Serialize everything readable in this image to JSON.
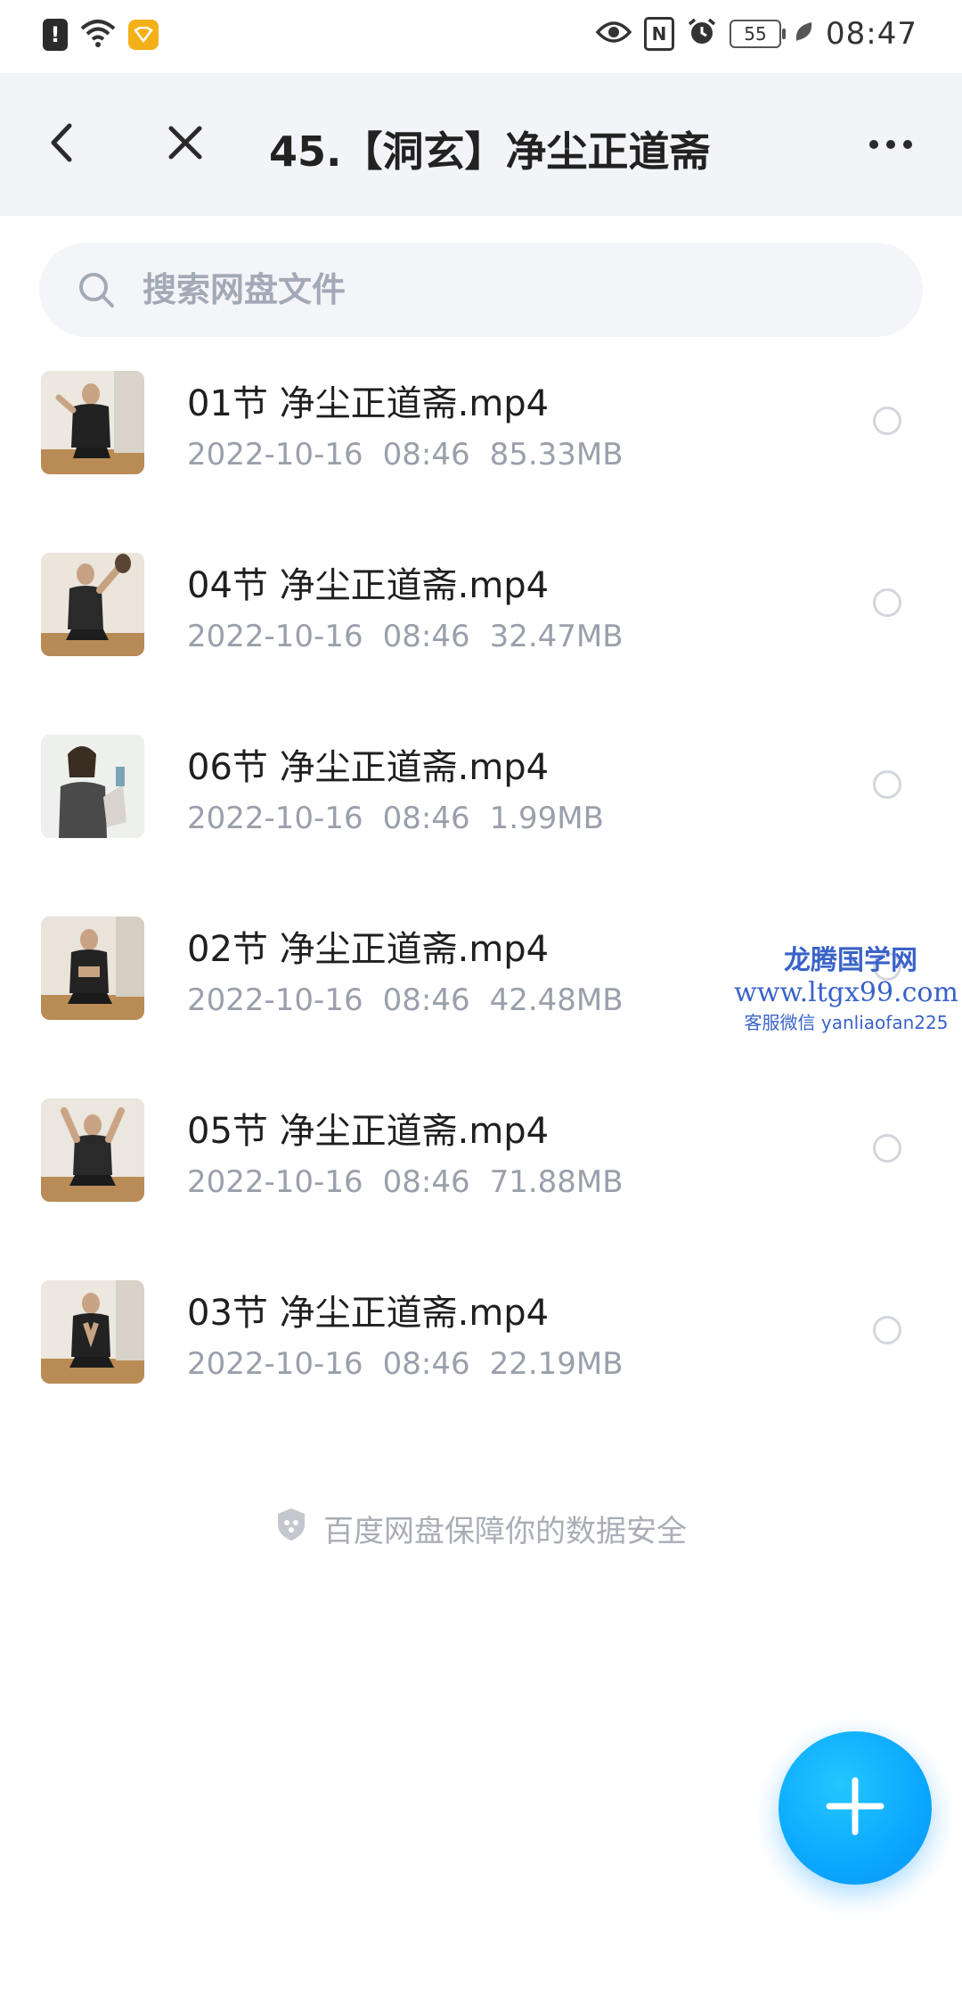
{
  "status_bar": {
    "time": "08:47",
    "battery": "55",
    "nfc_label": "N",
    "alert_label": "!"
  },
  "header": {
    "title": "45.【洞玄】净尘正道斋"
  },
  "search": {
    "placeholder": "搜索网盘文件"
  },
  "files": [
    {
      "name": "01节 净尘正道斋.mp4",
      "date": "2022-10-16",
      "time": "08:46",
      "size": "85.33MB"
    },
    {
      "name": "04节 净尘正道斋.mp4",
      "date": "2022-10-16",
      "time": "08:46",
      "size": "32.47MB"
    },
    {
      "name": "06节 净尘正道斋.mp4",
      "date": "2022-10-16",
      "time": "08:46",
      "size": "1.99MB"
    },
    {
      "name": "02节 净尘正道斋.mp4",
      "date": "2022-10-16",
      "time": "08:46",
      "size": "42.48MB"
    },
    {
      "name": "05节 净尘正道斋.mp4",
      "date": "2022-10-16",
      "time": "08:46",
      "size": "71.88MB"
    },
    {
      "name": "03节 净尘正道斋.mp4",
      "date": "2022-10-16",
      "time": "08:46",
      "size": "22.19MB"
    }
  ],
  "watermark": {
    "title": "龙腾国学网",
    "url": "www.ltgx99.com",
    "contact": "客服微信 yanliaofan225"
  },
  "footer": {
    "security_text": "百度网盘保障你的数据安全"
  },
  "colors": {
    "accent": "#0aa8ff",
    "header_bg": "#f3f4f7",
    "meta_text": "#9aa0ab"
  },
  "icons": {
    "back": "chevron-left-icon",
    "close": "close-icon",
    "more": "more-dots-icon",
    "search": "search-icon",
    "add": "plus-icon",
    "security": "shield-icon"
  }
}
